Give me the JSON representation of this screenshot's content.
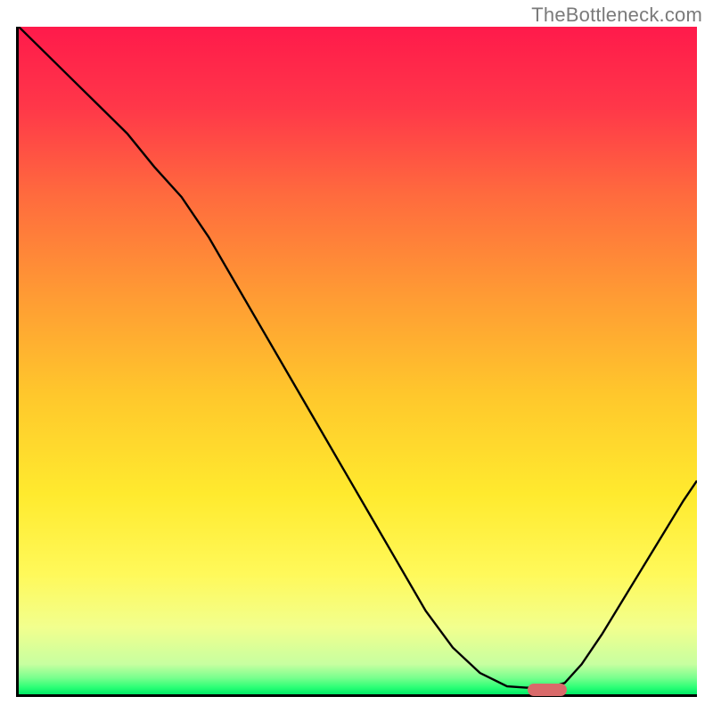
{
  "watermark": "TheBottleneck.com",
  "chart_data": {
    "type": "line",
    "title": "",
    "xlabel": "",
    "ylabel": "",
    "xlim": [
      0,
      100
    ],
    "ylim": [
      0,
      100
    ],
    "grid": false,
    "series": [
      {
        "name": "bottleneck-curve",
        "x": [
          0,
          4,
          8,
          12,
          16,
          20,
          24,
          28,
          32,
          36,
          40,
          44,
          48,
          52,
          56,
          60,
          64,
          68,
          72,
          74.8,
          78.2,
          80.5,
          83,
          86,
          89,
          92,
          95,
          98,
          100
        ],
        "values": [
          100,
          96,
          92,
          88,
          84,
          79,
          74.5,
          68.5,
          61.5,
          54.5,
          47.5,
          40.5,
          33.5,
          26.5,
          19.5,
          12.5,
          7.0,
          3.2,
          1.2,
          1.0,
          1.0,
          1.7,
          4.5,
          9.0,
          14.0,
          19.0,
          24.0,
          29.0,
          32.0
        ]
      }
    ],
    "marker": {
      "name": "optimal-range",
      "x_range": [
        74.8,
        80.5
      ],
      "y": 1.0,
      "color": "#d96a6a"
    },
    "gradient_stops": [
      {
        "pos": 0.0,
        "color": "#ff1a4b"
      },
      {
        "pos": 0.12,
        "color": "#ff3749"
      },
      {
        "pos": 0.25,
        "color": "#ff6a3e"
      },
      {
        "pos": 0.4,
        "color": "#ff9a34"
      },
      {
        "pos": 0.55,
        "color": "#ffc72c"
      },
      {
        "pos": 0.7,
        "color": "#ffea2e"
      },
      {
        "pos": 0.82,
        "color": "#fff95a"
      },
      {
        "pos": 0.9,
        "color": "#f2ff8e"
      },
      {
        "pos": 0.955,
        "color": "#c7ffa0"
      },
      {
        "pos": 0.975,
        "color": "#7aff8e"
      },
      {
        "pos": 0.99,
        "color": "#2aff75"
      },
      {
        "pos": 1.0,
        "color": "#00e865"
      }
    ]
  }
}
